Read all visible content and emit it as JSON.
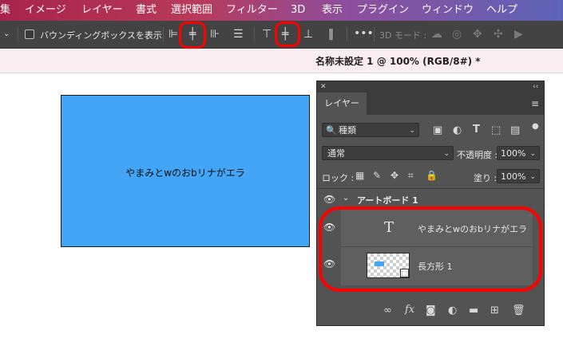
{
  "menu": [
    "集",
    "イメージ",
    "レイヤー",
    "書式",
    "選択範囲",
    "フィルター",
    "3D",
    "表示",
    "プラグイン",
    "ウィンドウ",
    "ヘルプ"
  ],
  "options": {
    "bounding_box_label": "バウンディングボックスを表示",
    "mode3d_label": "3D モード :"
  },
  "document_tab": "名称未設定 1 @ 100% (RGB/8#) *",
  "canvas": {
    "text": "やまみとwのおbリナがエラ"
  },
  "layers_panel": {
    "tab": "レイヤー",
    "filter_value": "種類",
    "blend_mode": "通常",
    "opacity_label": "不透明度 :",
    "opacity_value": "100%",
    "lock_label": "ロック :",
    "fill_label": "塗り :",
    "fill_value": "100%",
    "group_name": "アートボード 1",
    "layers": [
      {
        "name": "やまみとwのおbリナがエラ",
        "type_glyph": "T"
      },
      {
        "name": "長方形 1"
      }
    ]
  },
  "colors": {
    "artboard_fill": "#42a5f5",
    "annotation": "#ff0000",
    "panel_bg": "#535353"
  }
}
